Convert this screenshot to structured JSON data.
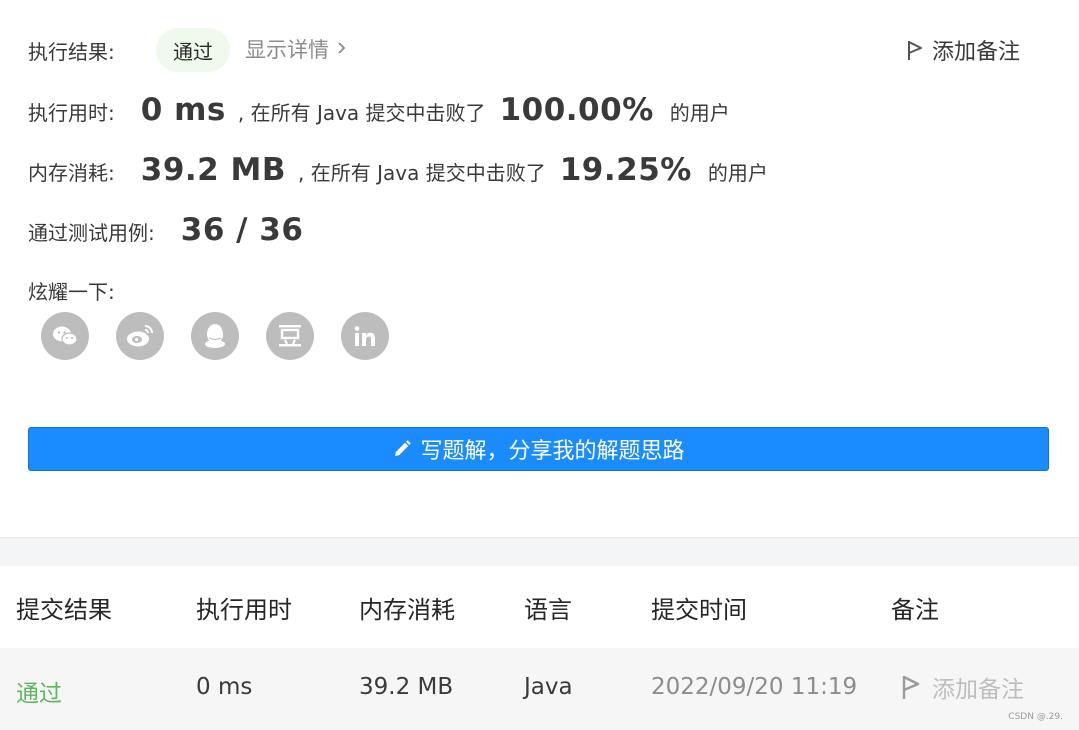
{
  "result": {
    "label": "执行结果:",
    "status": "通过",
    "details_link": "显示详情",
    "add_note": "添加备注"
  },
  "runtime": {
    "label": "执行用时:",
    "value": "0 ms",
    "middle": ", 在所有 Java 提交中击败了",
    "percent": "100.00%",
    "suffix": "的用户"
  },
  "memory": {
    "label": "内存消耗:",
    "value": "39.2 MB",
    "middle": ", 在所有 Java 提交中击败了",
    "percent": "19.25%",
    "suffix": "的用户"
  },
  "tests": {
    "label": "通过测试用例:",
    "value": "36 / 36"
  },
  "share": {
    "label": "炫耀一下:",
    "icons": [
      "wechat-icon",
      "weibo-icon",
      "qq-icon",
      "douban-icon",
      "linkedin-icon"
    ]
  },
  "write_solution": {
    "label": "写题解，分享我的解题思路"
  },
  "table": {
    "headers": [
      "提交结果",
      "执行用时",
      "内存消耗",
      "语言",
      "提交时间",
      "备注"
    ],
    "rows": [
      {
        "result": "通过",
        "runtime": "0 ms",
        "memory": "39.2 MB",
        "language": "Java",
        "time": "2022/09/20 11:19",
        "note": "添加备注"
      }
    ]
  },
  "watermark": "CSDN @.29.",
  "colors": {
    "accent": "#1a8cff",
    "pass_green": "#5cb85c",
    "pill_bg": "#eff9ec",
    "icon_gray": "#bdbdbd"
  }
}
